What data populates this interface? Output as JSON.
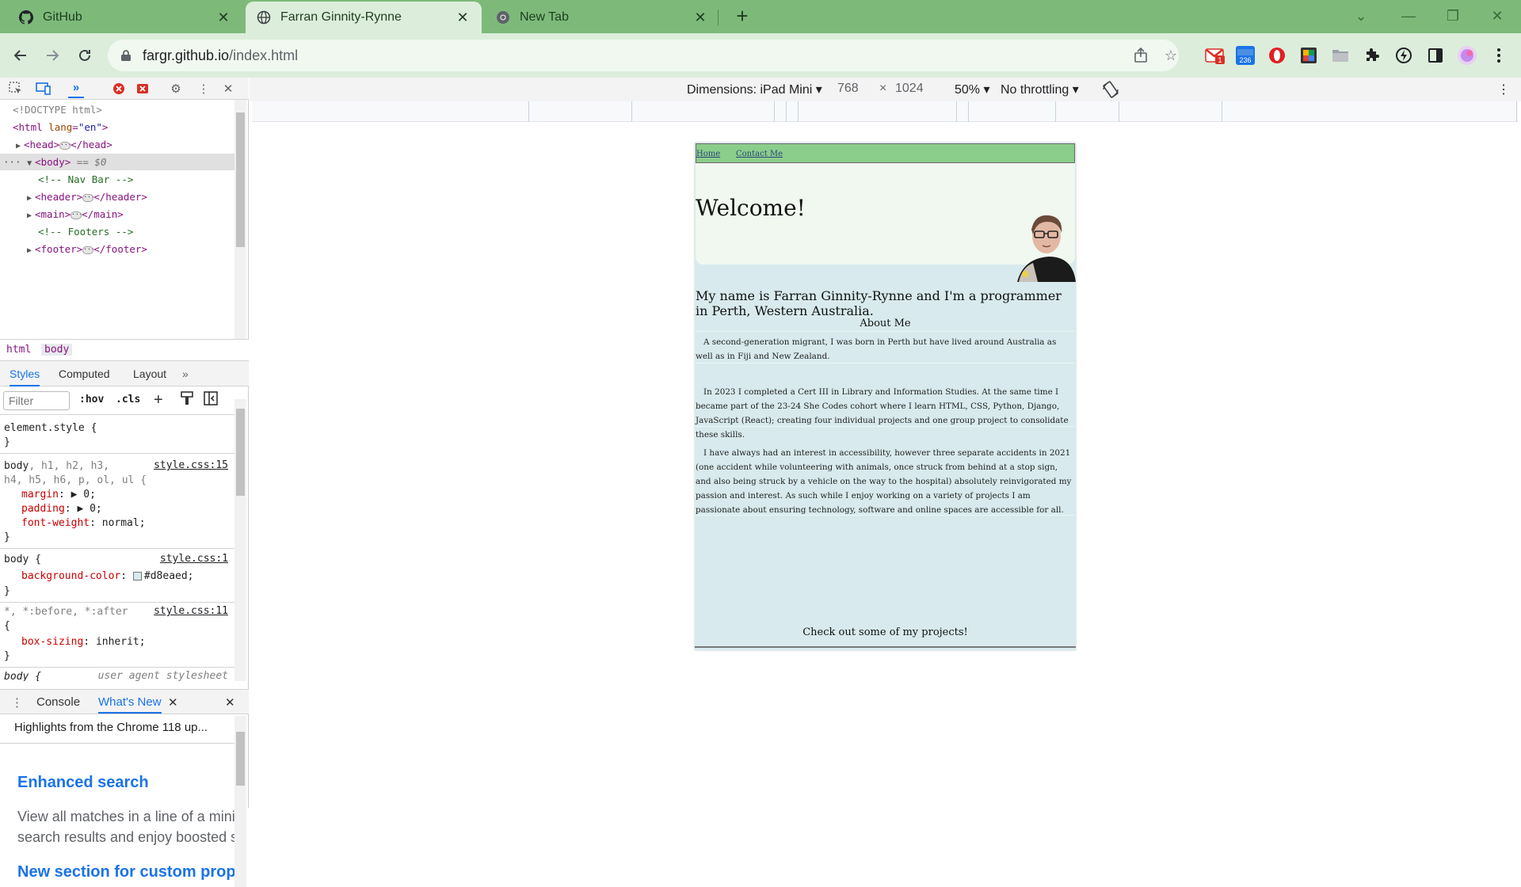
{
  "browser": {
    "tabs": [
      {
        "title": "GitHub",
        "icon": "github-icon"
      },
      {
        "title": "Farran Ginnity-Rynne",
        "icon": "globe-icon",
        "active": true
      },
      {
        "title": "New Tab",
        "icon": "chrome-icon"
      }
    ],
    "url_host": "fargr.github.io",
    "url_path": "/index.html",
    "extensions": {
      "gmail_badge": "1",
      "calendar_badge": "236"
    }
  },
  "devtools": {
    "tree": {
      "doctype": "<!DOCTYPE html>",
      "html_open_tag": "<html",
      "html_attr_name": "lang",
      "html_attr_value": "\"en\"",
      "html_close": ">",
      "head_open": "<head>",
      "head_close": "</head>",
      "body_open": "<body>",
      "body_eq": "== $0",
      "comment_nav": "<!-- Nav Bar    -->",
      "header_open": "<header>",
      "header_close": "</header>",
      "main_open": "<main>",
      "main_close": "</main>",
      "comment_footer": "<!-- Footers -->",
      "footer_open": "<footer>",
      "footer_close": "</footer>"
    },
    "breadcrumbs": [
      "html",
      "body"
    ],
    "style_tabs": [
      "Styles",
      "Computed",
      "Layout"
    ],
    "filter_placeholder": "Filter",
    "hov": ":hov",
    "cls": ".cls",
    "rules": {
      "element_style": "element.style {",
      "close": "}",
      "rule1_selector_a": "body",
      "rule1_selector_b": ", h1, h2, h3,",
      "rule1_selector_c": "h4, h5, h6, p, ol, ul {",
      "rule1_source": "style.css:15",
      "margin_prop": "margin",
      "margin_val": "0;",
      "padding_prop": "padding",
      "padding_val": "0;",
      "fw_prop": "font-weight",
      "fw_val": "normal;",
      "rule2_selector": "body {",
      "rule2_source": "style.css:1",
      "bg_prop": "background-color",
      "bg_val": "#d8eaed;",
      "rule3_selector": "*, *:before, *:after",
      "rule3_source": "style.css:11",
      "open_brace": "{",
      "bs_prop": "box-sizing",
      "bs_val": "inherit;",
      "rule4_selector": "body {",
      "rule4_source": "user agent stylesheet"
    },
    "drawer_tabs": [
      "Console",
      "What's New"
    ],
    "whats_new": {
      "highlight": "Highlights from the Chrome 118 up...",
      "h1": "Enhanced search",
      "p1_line1": "View all matches in a line of a minif",
      "p1_line2": "search results and enjoy boosted se",
      "h2": "New section for custom prop"
    }
  },
  "device_toolbar": {
    "dimensions": "Dimensions: iPad Mini",
    "width": "768",
    "times": "×",
    "height": "1024",
    "zoom": "50%",
    "throttling": "No throttling"
  },
  "site": {
    "nav": [
      "Home",
      "Contact Me"
    ],
    "welcome": "Welcome!",
    "intro": "My name is Farran Ginnity-Rynne and I'm a programmer in Perth, Western Australia.",
    "about_title": "About Me",
    "paragraphs": [
      "A second-generation migrant, I was born in Perth but have lived around Australia as well as in Fiji and New Zealand.",
      "In 2023 I completed a Cert III in Library and Information Studies. At the same time I became part of the 23-24 She Codes cohort where I learn HTML, CSS, Python, Django, JavaScript (React); creating four individual projects and one group project to consolidate these skills.",
      "I have always had an interest in accessibility, however three separate accidents in 2021 (one accident while volunteering with animals, once struck from behind at a stop sign, and also being struck by a vehicle on the way to the hospital) absolutely reinvigorated my passion and interest. As such while I enjoy working on a variety of projects I am passionate about ensuring technology, software and online spaces are accessible for all."
    ],
    "projects_title": "Check out some of my projects!"
  }
}
